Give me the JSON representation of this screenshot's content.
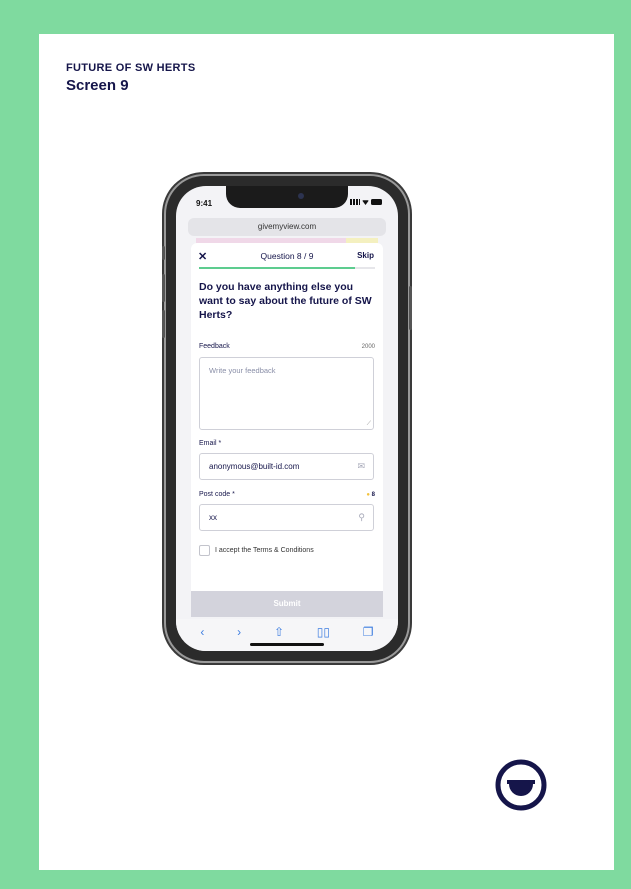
{
  "header": {
    "kicker": "FUTURE OF SW HERTS",
    "screen_title": "Screen 9"
  },
  "colors": {
    "frame_green": "#7fda9f",
    "navy": "#15154a",
    "progress_green": "#5dcc8f",
    "submit_disabled": "#d3d3dc"
  },
  "phone": {
    "status_time": "9:41",
    "url": "givemyview.com"
  },
  "survey": {
    "close_icon": "close-icon",
    "question_counter": "Question 8 / 9",
    "skip_label": "Skip",
    "progress": 0.889,
    "question": "Do you have anything else you want to say about the future of SW Herts?",
    "feedback_label": "Feedback",
    "feedback_limit": "2000",
    "feedback_placeholder": "Write your feedback",
    "email_label": "Email *",
    "email_value": "anonymous@built-id.com",
    "email_icon": "mail-icon",
    "postcode_label": "Post code *",
    "postcode_badge": "8",
    "postcode_value": "xx",
    "postcode_icon": "map-pin-icon",
    "terms_label": "I accept the Terms & Conditions",
    "submit_label": "Submit"
  },
  "toolbar": {
    "back": "‹",
    "forward": "›",
    "share": "⇧",
    "bookmarks": "▯▯",
    "tabs": "❐"
  }
}
